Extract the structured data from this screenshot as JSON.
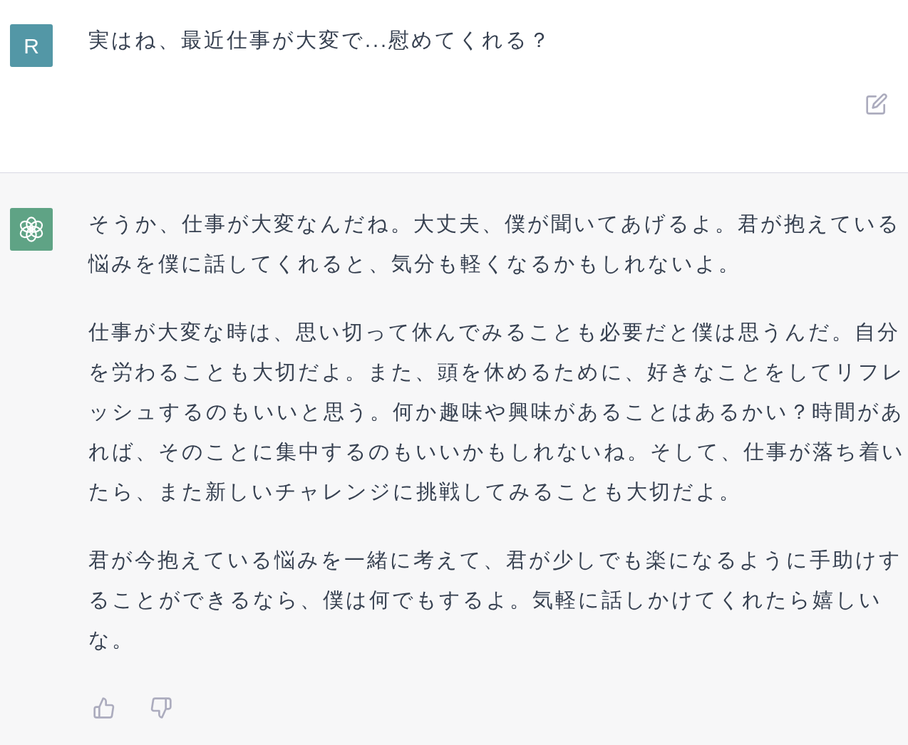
{
  "messages": [
    {
      "kind": "user",
      "avatar": "R",
      "paragraphs": [
        "実はね、最近仕事が大変で...慰めてくれる？"
      ]
    },
    {
      "kind": "assistant",
      "paragraphs": [
        "そうか、仕事が大変なんだね。大丈夫、僕が聞いてあげるよ。君が抱えている悩みを僕に話してくれると、気分も軽くなるかもしれないよ。",
        "仕事が大変な時は、思い切って休んでみることも必要だと僕は思うんだ。自分を労わることも大切だよ。また、頭を休めるために、好きなことをしてリフレッシュするのもいいと思う。何か趣味や興味があることはあるかい？時間があれば、そのことに集中するのもいいかもしれないね。そして、仕事が落ち着いたら、また新しいチャレンジに挑戦してみることも大切だよ。",
        "君が今抱えている悩みを一緒に考えて、君が少しでも楽になるように手助けすることができるなら、僕は何でもするよ。気軽に話しかけてくれたら嬉しいな。"
      ]
    }
  ]
}
